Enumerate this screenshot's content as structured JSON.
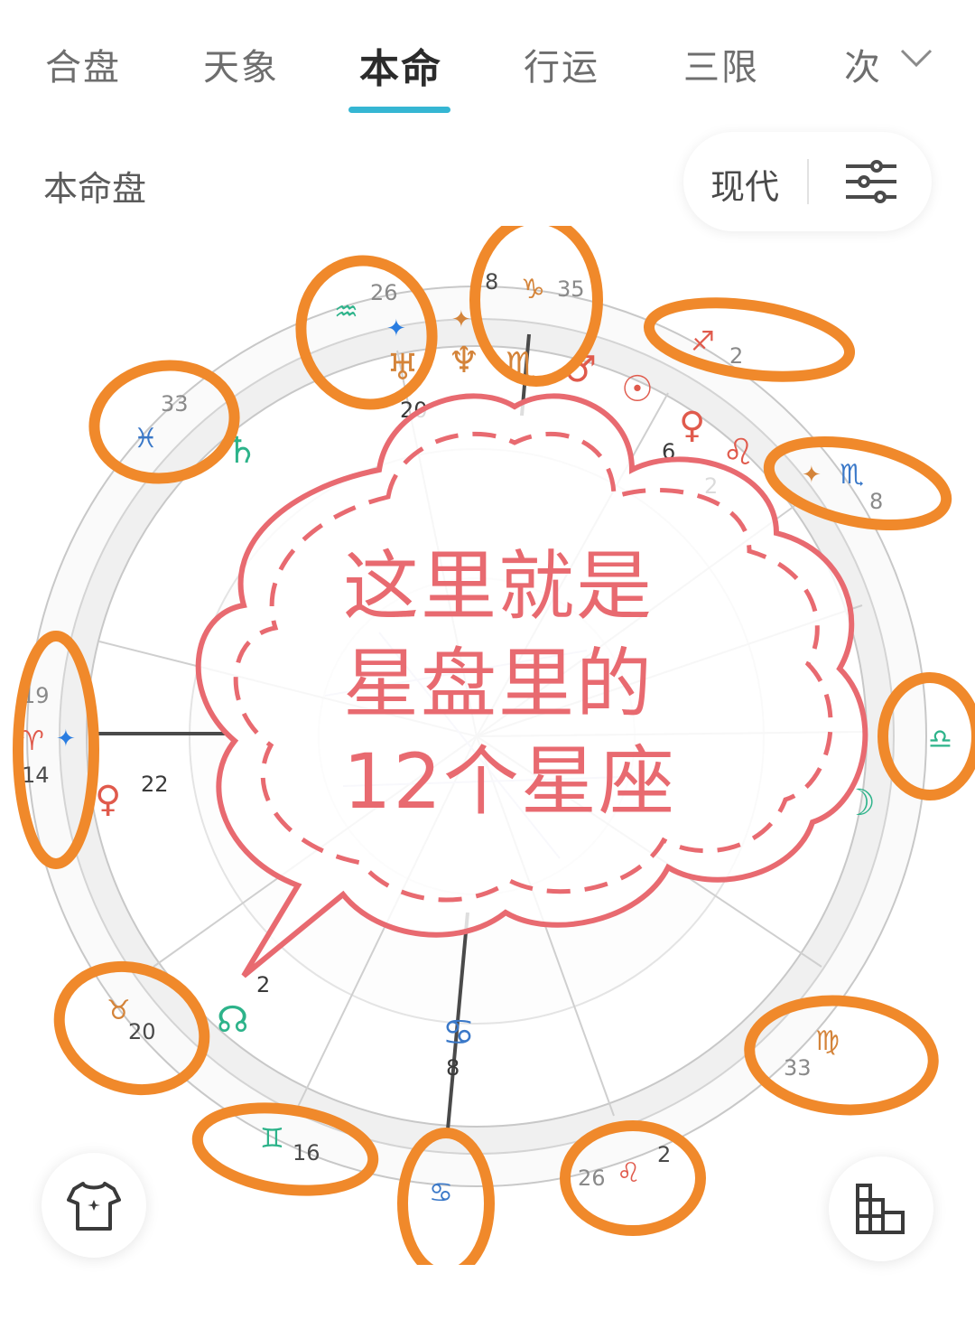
{
  "tabs": [
    {
      "label": "合盘"
    },
    {
      "label": "天象"
    },
    {
      "label": "本命",
      "active": true
    },
    {
      "label": "行运"
    },
    {
      "label": "三限"
    },
    {
      "label": "次"
    }
  ],
  "header": {
    "title": "本命盘",
    "mode_label": "现代"
  },
  "annotation": {
    "line1": "这里就是",
    "line2": "星盘里的",
    "line3": "12个星座"
  },
  "zodiac_ring": [
    {
      "glyph": "♒",
      "degree": "26",
      "color": "#2db38a"
    },
    {
      "glyph": "♑",
      "degree": "35",
      "extra": "8",
      "color": "#d4843a"
    },
    {
      "glyph": "♐",
      "degree": "2",
      "color": "#e05a4c"
    },
    {
      "glyph": "♏",
      "degree": "8",
      "color": "#3a78c8"
    },
    {
      "glyph": "♎",
      "degree": "",
      "color": "#2db38a"
    },
    {
      "glyph": "♍",
      "degree": "33",
      "color": "#d4843a"
    },
    {
      "glyph": "♌",
      "degree": "26",
      "extra": "2",
      "color": "#e05a4c"
    },
    {
      "glyph": "♋",
      "degree": "",
      "color": "#3a78c8"
    },
    {
      "glyph": "♊",
      "degree": "16",
      "color": "#2db38a"
    },
    {
      "glyph": "♉",
      "degree": "20",
      "color": "#d4843a"
    },
    {
      "glyph": "♈",
      "degree": "14",
      "extra": "19",
      "color": "#e05a4c"
    },
    {
      "glyph": "♓",
      "degree": "33",
      "color": "#3a78c8"
    }
  ],
  "planets": [
    {
      "glyph": "♅",
      "color": "#d4843a"
    },
    {
      "glyph": "♆",
      "color": "#d4843a"
    },
    {
      "glyph": "♏",
      "color": "#d4843a"
    },
    {
      "glyph": "♂",
      "color": "#e05a4c"
    },
    {
      "glyph": "☉",
      "color": "#e05a4c"
    },
    {
      "glyph": "♀",
      "color": "#e05a4c"
    },
    {
      "glyph": "♌",
      "color": "#e05a4c"
    },
    {
      "glyph": "♄",
      "color": "#2db38a"
    },
    {
      "glyph": "♀",
      "color": "#e05a4c"
    },
    {
      "glyph": "☽",
      "color": "#2db38a"
    },
    {
      "glyph": "☊",
      "color": "#2db38a"
    },
    {
      "glyph": "♋",
      "color": "#3a78c8"
    }
  ],
  "house_numbers": [
    "20",
    "6",
    "2",
    "22",
    "2",
    "8"
  ],
  "colors": {
    "accent": "#35b6d3",
    "highlight": "#f0892b",
    "cloud": "#e86a70"
  }
}
